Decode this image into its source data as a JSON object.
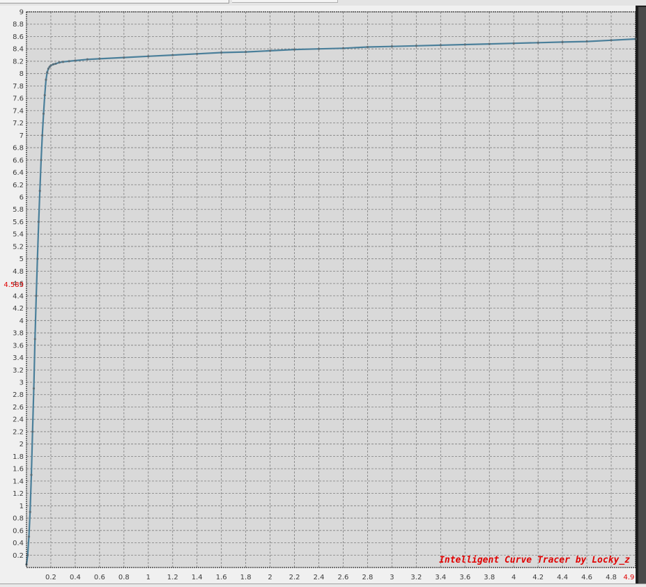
{
  "window": {
    "watermark": "Intelligent Curve Tracer by Locky_z",
    "cursor_y_readout": "4.583",
    "cursor_x_readout": "4.9"
  },
  "colors": {
    "plot_background": "#d9d9d9",
    "grid": "#7d7d7d",
    "curve": "#4a7f9a",
    "accent_red": "#e00000"
  },
  "chart_data": {
    "type": "line",
    "title": "",
    "xlabel": "",
    "ylabel": "",
    "xlim": [
      0,
      5
    ],
    "ylim": [
      0,
      9
    ],
    "grid": true,
    "x_ticks": [
      "0.2",
      "0.4",
      "0.6",
      "0.8",
      "1",
      "1.2",
      "1.4",
      "1.6",
      "1.8",
      "2",
      "2.2",
      "2.4",
      "2.6",
      "2.8",
      "3",
      "3.2",
      "3.4",
      "3.6",
      "3.8",
      "4",
      "4.2",
      "4.4",
      "4.6",
      "4.8"
    ],
    "y_ticks": [
      "0.2",
      "0.4",
      "0.6",
      "0.8",
      "1",
      "1.2",
      "1.4",
      "1.6",
      "1.8",
      "2",
      "2.2",
      "2.4",
      "2.6",
      "2.8",
      "3",
      "3.2",
      "3.4",
      "3.6",
      "3.8",
      "4",
      "4.2",
      "4.4",
      "4.6",
      "4.8",
      "5",
      "5.2",
      "5.4",
      "5.6",
      "5.8",
      "6",
      "6.2",
      "6.4",
      "6.6",
      "6.8",
      "7",
      "7.2",
      "7.4",
      "7.6",
      "7.8",
      "8",
      "8.2",
      "8.4",
      "8.6",
      "8.8",
      "9"
    ],
    "series": [
      {
        "x": [
          0,
          0.01,
          0.02,
          0.03,
          0.04,
          0.05,
          0.06,
          0.07,
          0.08,
          0.09,
          0.1,
          0.11,
          0.12,
          0.13,
          0.14,
          0.15,
          0.16,
          0.17,
          0.18,
          0.19,
          0.2,
          0.22,
          0.24,
          0.27,
          0.3,
          0.35,
          0.4,
          0.5,
          0.6,
          0.8,
          1,
          1.2,
          1.4,
          1.6,
          1.8,
          2,
          2.2,
          2.4,
          2.6,
          2.8,
          3,
          3.2,
          3.4,
          3.6,
          3.8,
          4,
          4.2,
          4.4,
          4.6,
          4.8,
          5
        ],
        "y": [
          0.05,
          0.2,
          0.5,
          0.9,
          1.5,
          2.2,
          2.9,
          3.7,
          4.4,
          5.0,
          5.6,
          6.1,
          6.6,
          7.0,
          7.35,
          7.65,
          7.9,
          8.02,
          8.08,
          8.11,
          8.13,
          8.15,
          8.16,
          8.18,
          8.19,
          8.2,
          8.21,
          8.23,
          8.24,
          8.26,
          8.28,
          8.3,
          8.32,
          8.34,
          8.35,
          8.37,
          8.39,
          8.4,
          8.41,
          8.43,
          8.44,
          8.45,
          8.46,
          8.47,
          8.48,
          8.49,
          8.5,
          8.51,
          8.52,
          8.54,
          8.56
        ]
      }
    ]
  }
}
